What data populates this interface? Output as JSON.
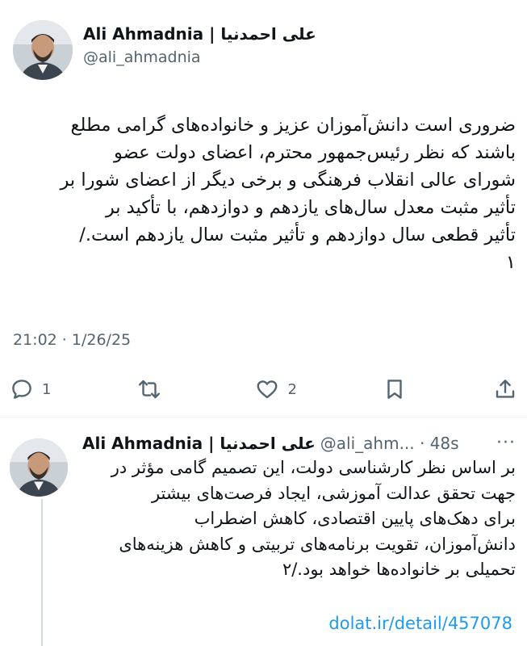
{
  "tweet": {
    "author_name": "Ali Ahmadnia | علی احمدنیا",
    "handle": "@ali_ahmadnia",
    "text": "ضروری است دانش‌آموزان عزیز و خانواده‌های گرامی مطلع\nباشند که نظر رئیس‌جمهور محترم، اعضای دولت عضو\nشورای عالی انقلاب فرهنگی و برخی دیگر از اعضای شورا بر\nتأثیر مثبت معدل سال‌های یازدهم و دوازدهم، با تأکید بر\nتأثیر قطعی سال دوازدهم و تأثیر مثبت سال یازدهم است./\n۱",
    "time": "21:02 · 1/26/25",
    "actions": {
      "reply_count": "1",
      "retweet_count": "",
      "like_count": "2"
    }
  },
  "reply": {
    "author_name": "Ali Ahmadnia | علی احمدنیا",
    "handle_time": "@ali_ahm... · 48s",
    "more": "···",
    "text": "بر اساس نظر کارشناسی دولت، این تصمیم گامی مؤثر در\nجهت تحقق عدالت آموزشی، ایجاد فرصت‌های بیشتر\nبرای دهک‌های پایین اقتصادی، کاهش اضطراب\nدانش‌آموزان، تقویت برنامه‌های تربیتی و کاهش هزینه‌های\nتحمیلی بر خانواده‌ها خواهد بود./۲",
    "link": "dolat.ir/detail/457078"
  },
  "colors": {
    "text": "#0f1419",
    "secondary": "#536471",
    "link": "#1d9bf0",
    "divider": "#eff3f4"
  }
}
